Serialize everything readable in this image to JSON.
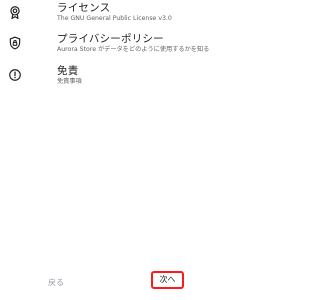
{
  "items": [
    {
      "icon": "certificate-icon",
      "title": "ライセンス",
      "subtitle": "The GNU General Public License v3.0"
    },
    {
      "icon": "shield-lock-icon",
      "title": "プライバシーポリシー",
      "subtitle": "Aurora Store がデータをどのように使用するかを知る"
    },
    {
      "icon": "alert-circle-icon",
      "title": "免責",
      "subtitle": "免責事項"
    }
  ],
  "footer": {
    "back_label": "戻る",
    "next_label": "次へ"
  },
  "colors": {
    "title_text": "#202124",
    "subtitle_text": "#5f6368",
    "disabled_text": "#9aa0a6",
    "highlight_border": "#ff1a1a"
  }
}
